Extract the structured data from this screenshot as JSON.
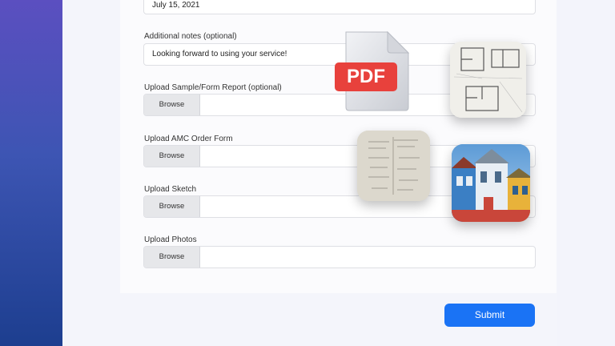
{
  "form": {
    "date_value": "July 15, 2021",
    "notes": {
      "label": "Additional notes (optional)",
      "value": "Looking forward to using your service!"
    },
    "uploads": [
      {
        "label": "Upload Sample/Form Report (optional)",
        "button": "Browse"
      },
      {
        "label": "Upload AMC Order Form",
        "button": "Browse"
      },
      {
        "label": "Upload Sketch",
        "button": "Browse"
      },
      {
        "label": "Upload Photos",
        "button": "Browse"
      }
    ],
    "submit_label": "Submit"
  },
  "decorations": {
    "pdf_badge": "PDF",
    "icons": [
      "pdf-file-icon",
      "floor-plan-thumbnail",
      "sketch-document-thumbnail",
      "house-photo-thumbnail"
    ]
  },
  "colors": {
    "accent": "#1a73f5",
    "pdf_red": "#e8413c",
    "sidebar_top": "#5b4fc0",
    "sidebar_bottom": "#1d3e8f"
  }
}
